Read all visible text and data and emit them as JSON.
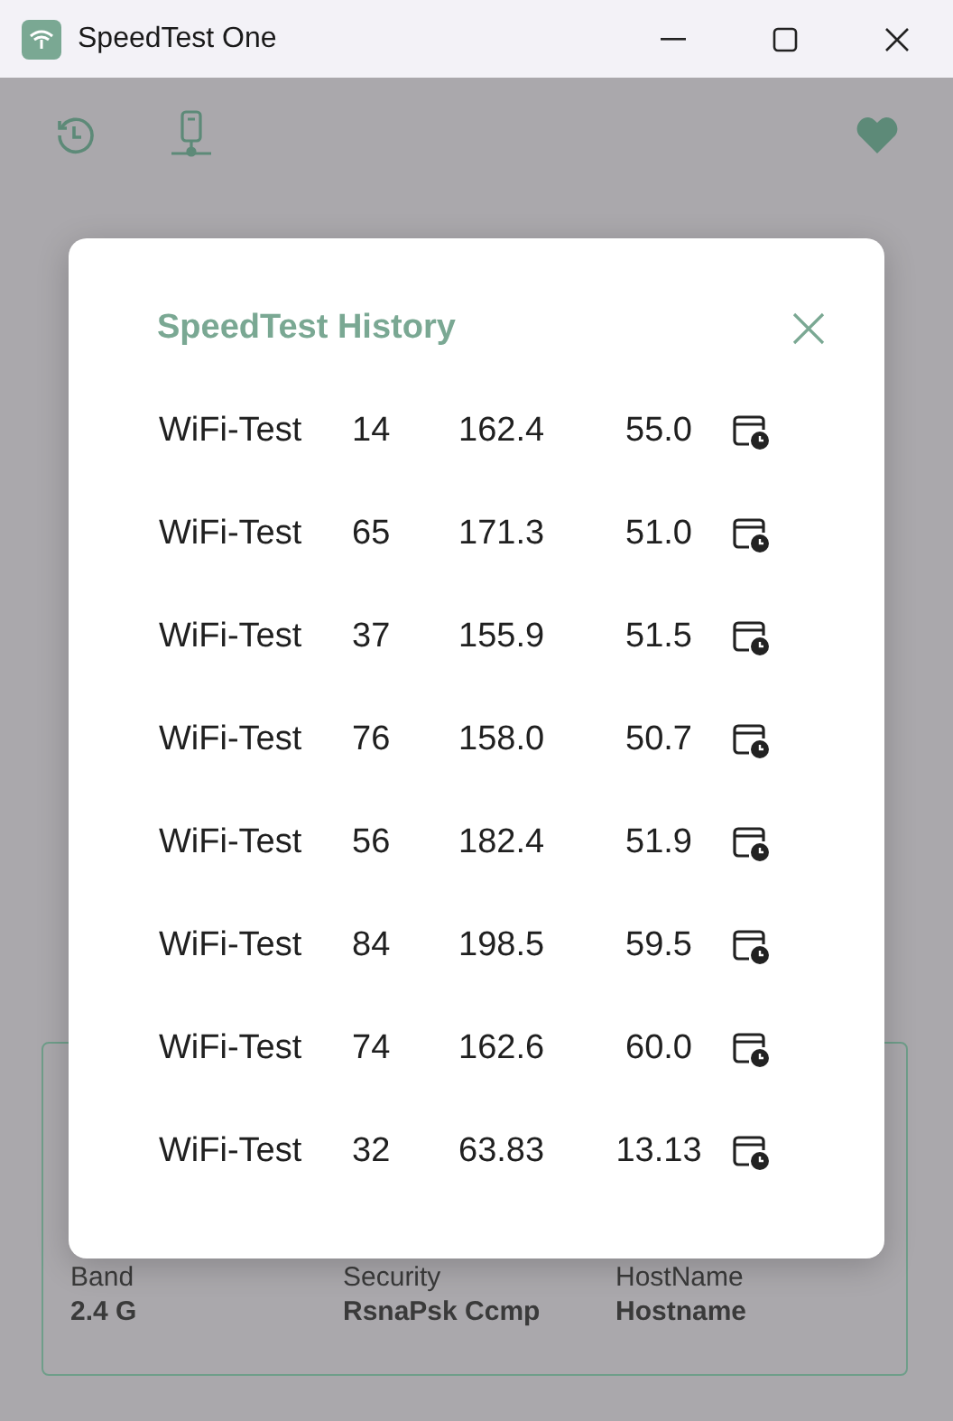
{
  "window": {
    "title": "SpeedTest One"
  },
  "dialog": {
    "title": "SpeedTest History",
    "rows": [
      {
        "name": "WiFi-Test",
        "column_2": "14",
        "column_3": "162.4",
        "column_4": "55.0"
      },
      {
        "name": "WiFi-Test",
        "column_2": "65",
        "column_3": "171.3",
        "column_4": "51.0"
      },
      {
        "name": "WiFi-Test",
        "column_2": "37",
        "column_3": "155.9",
        "column_4": "51.5"
      },
      {
        "name": "WiFi-Test",
        "column_2": "76",
        "column_3": "158.0",
        "column_4": "50.7"
      },
      {
        "name": "WiFi-Test",
        "column_2": "56",
        "column_3": "182.4",
        "column_4": "51.9"
      },
      {
        "name": "WiFi-Test",
        "column_2": "84",
        "column_3": "198.5",
        "column_4": "59.5"
      },
      {
        "name": "WiFi-Test",
        "column_2": "74",
        "column_3": "162.6",
        "column_4": "60.0"
      },
      {
        "name": "WiFi-Test",
        "column_2": "32",
        "column_3": "63.83",
        "column_4": "13.13"
      }
    ]
  },
  "network_info": [
    {
      "label": "Band",
      "value": "2.4 G"
    },
    {
      "label": "Security",
      "value": "RsnaPsk Ccmp"
    },
    {
      "label": "HostName",
      "value": "Hostname"
    }
  ]
}
